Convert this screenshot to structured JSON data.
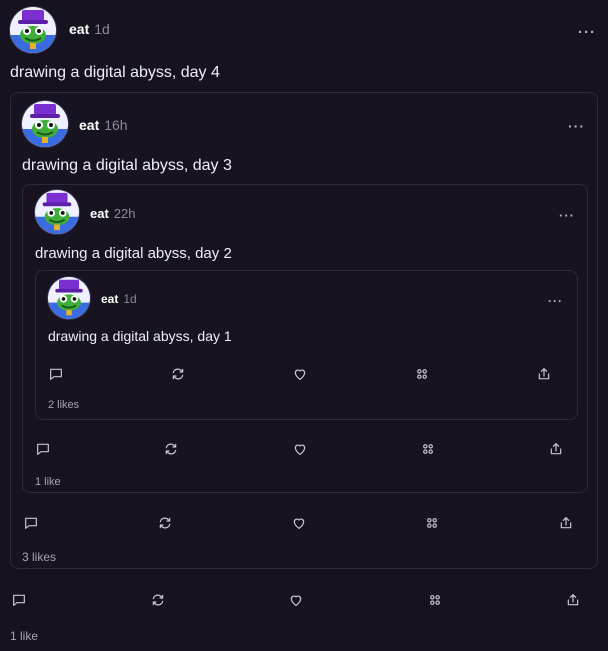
{
  "post4": {
    "author": "eat",
    "time": "1d",
    "text": "drawing a digital abyss, day 4",
    "likes": "1 like"
  },
  "post3": {
    "author": "eat",
    "time": "16h",
    "text": "drawing a digital abyss, day 3",
    "likes": "3 likes"
  },
  "post2": {
    "author": "eat",
    "time": "22h",
    "text": "drawing a digital abyss, day 2",
    "likes": "1 like"
  },
  "post1": {
    "author": "eat",
    "time": "1d",
    "text": "drawing a digital abyss, day 1",
    "likes": "2 likes"
  },
  "menu_glyph": "···",
  "icons": [
    "comment-icon",
    "repost-icon",
    "heart-icon",
    "grid-icon",
    "share-icon"
  ],
  "colors": {
    "background": "#16121f",
    "border": "#2e2a3a",
    "muted": "#8e8a99"
  }
}
